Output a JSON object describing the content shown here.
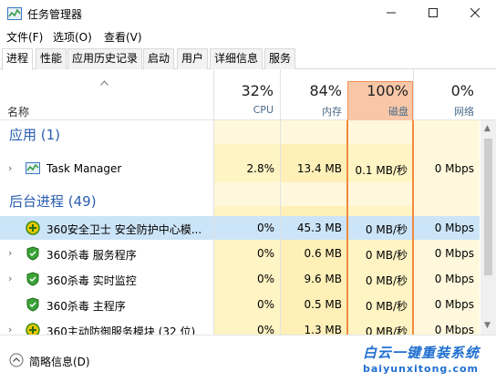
{
  "window": {
    "title": "任务管理器"
  },
  "menu": [
    "文件(F)",
    "选项(O)",
    "查看(V)"
  ],
  "tabs": [
    "进程",
    "性能",
    "应用历史记录",
    "启动",
    "用户",
    "详细信息",
    "服务"
  ],
  "columns": {
    "name_label": "名称",
    "cpu": {
      "pct": "32%",
      "label": "CPU"
    },
    "mem": {
      "pct": "84%",
      "label": "内存"
    },
    "disk": {
      "pct": "100%",
      "label": "磁盘"
    },
    "net": {
      "pct": "0%",
      "label": "网络"
    }
  },
  "groups": {
    "apps_title": "应用 (1)",
    "bg_title": "后台进程 (49)"
  },
  "rows": [
    {
      "name": "Task Manager",
      "cpu": "2.8%",
      "mem": "13.4 MB",
      "disk": "0.1 MB/秒",
      "net": "0 Mbps",
      "icon": "task-manager-icon"
    },
    {
      "name": "360安全卫士 安全防护中心模...",
      "cpu": "0%",
      "mem": "45.3 MB",
      "disk": "0 MB/秒",
      "net": "0 Mbps",
      "icon": "360-safe-icon"
    },
    {
      "name": "360杀毒 服务程序",
      "cpu": "0%",
      "mem": "0.6 MB",
      "disk": "0 MB/秒",
      "net": "0 Mbps",
      "icon": "360-antivirus-icon"
    },
    {
      "name": "360杀毒 实时监控",
      "cpu": "0%",
      "mem": "9.6 MB",
      "disk": "0 MB/秒",
      "net": "0 Mbps",
      "icon": "360-antivirus-icon"
    },
    {
      "name": "360杀毒 主程序",
      "cpu": "0%",
      "mem": "0.5 MB",
      "disk": "0 MB/秒",
      "net": "0 Mbps",
      "icon": "360-antivirus-icon"
    },
    {
      "name": "360主动防御服务模块 (32 位)",
      "cpu": "0%",
      "mem": "1.3 MB",
      "disk": "0 MB/秒",
      "net": "0 Mbps",
      "icon": "360-safe-icon"
    }
  ],
  "footer": {
    "fewer_details": "简略信息(D)"
  },
  "watermark": {
    "title": "白云一键重装系统",
    "url": "baiyunxitong.com"
  },
  "colors": {
    "accent": "#2a5db0",
    "disk_highlight": "#f7c7a8",
    "disk_border": "#f08a3e",
    "cell_yellow": "#fff4c4",
    "cell_yellow_strong": "#ffe9a8",
    "selected": "#cce4f7"
  }
}
